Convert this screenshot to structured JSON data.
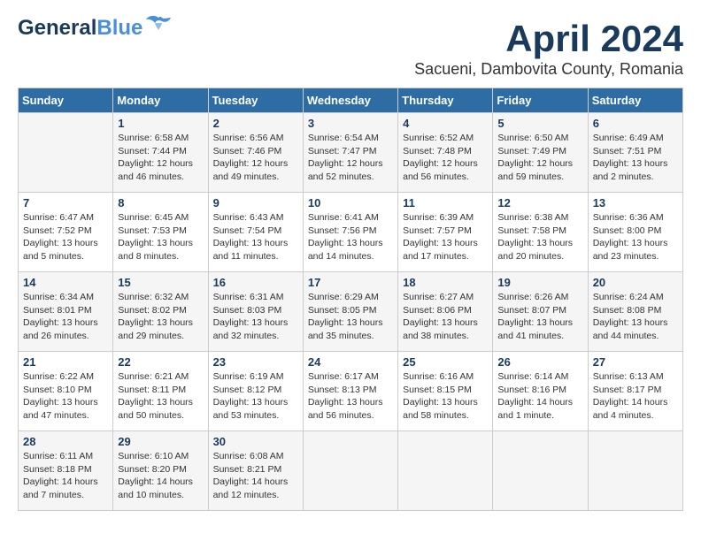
{
  "header": {
    "logo_general": "General",
    "logo_blue": "Blue",
    "month_title": "April 2024",
    "subtitle": "Sacueni, Dambovita County, Romania"
  },
  "days_of_week": [
    "Sunday",
    "Monday",
    "Tuesday",
    "Wednesday",
    "Thursday",
    "Friday",
    "Saturday"
  ],
  "weeks": [
    [
      {
        "day": "",
        "info": ""
      },
      {
        "day": "1",
        "info": "Sunrise: 6:58 AM\nSunset: 7:44 PM\nDaylight: 12 hours\nand 46 minutes."
      },
      {
        "day": "2",
        "info": "Sunrise: 6:56 AM\nSunset: 7:46 PM\nDaylight: 12 hours\nand 49 minutes."
      },
      {
        "day": "3",
        "info": "Sunrise: 6:54 AM\nSunset: 7:47 PM\nDaylight: 12 hours\nand 52 minutes."
      },
      {
        "day": "4",
        "info": "Sunrise: 6:52 AM\nSunset: 7:48 PM\nDaylight: 12 hours\nand 56 minutes."
      },
      {
        "day": "5",
        "info": "Sunrise: 6:50 AM\nSunset: 7:49 PM\nDaylight: 12 hours\nand 59 minutes."
      },
      {
        "day": "6",
        "info": "Sunrise: 6:49 AM\nSunset: 7:51 PM\nDaylight: 13 hours\nand 2 minutes."
      }
    ],
    [
      {
        "day": "7",
        "info": "Sunrise: 6:47 AM\nSunset: 7:52 PM\nDaylight: 13 hours\nand 5 minutes."
      },
      {
        "day": "8",
        "info": "Sunrise: 6:45 AM\nSunset: 7:53 PM\nDaylight: 13 hours\nand 8 minutes."
      },
      {
        "day": "9",
        "info": "Sunrise: 6:43 AM\nSunset: 7:54 PM\nDaylight: 13 hours\nand 11 minutes."
      },
      {
        "day": "10",
        "info": "Sunrise: 6:41 AM\nSunset: 7:56 PM\nDaylight: 13 hours\nand 14 minutes."
      },
      {
        "day": "11",
        "info": "Sunrise: 6:39 AM\nSunset: 7:57 PM\nDaylight: 13 hours\nand 17 minutes."
      },
      {
        "day": "12",
        "info": "Sunrise: 6:38 AM\nSunset: 7:58 PM\nDaylight: 13 hours\nand 20 minutes."
      },
      {
        "day": "13",
        "info": "Sunrise: 6:36 AM\nSunset: 8:00 PM\nDaylight: 13 hours\nand 23 minutes."
      }
    ],
    [
      {
        "day": "14",
        "info": "Sunrise: 6:34 AM\nSunset: 8:01 PM\nDaylight: 13 hours\nand 26 minutes."
      },
      {
        "day": "15",
        "info": "Sunrise: 6:32 AM\nSunset: 8:02 PM\nDaylight: 13 hours\nand 29 minutes."
      },
      {
        "day": "16",
        "info": "Sunrise: 6:31 AM\nSunset: 8:03 PM\nDaylight: 13 hours\nand 32 minutes."
      },
      {
        "day": "17",
        "info": "Sunrise: 6:29 AM\nSunset: 8:05 PM\nDaylight: 13 hours\nand 35 minutes."
      },
      {
        "day": "18",
        "info": "Sunrise: 6:27 AM\nSunset: 8:06 PM\nDaylight: 13 hours\nand 38 minutes."
      },
      {
        "day": "19",
        "info": "Sunrise: 6:26 AM\nSunset: 8:07 PM\nDaylight: 13 hours\nand 41 minutes."
      },
      {
        "day": "20",
        "info": "Sunrise: 6:24 AM\nSunset: 8:08 PM\nDaylight: 13 hours\nand 44 minutes."
      }
    ],
    [
      {
        "day": "21",
        "info": "Sunrise: 6:22 AM\nSunset: 8:10 PM\nDaylight: 13 hours\nand 47 minutes."
      },
      {
        "day": "22",
        "info": "Sunrise: 6:21 AM\nSunset: 8:11 PM\nDaylight: 13 hours\nand 50 minutes."
      },
      {
        "day": "23",
        "info": "Sunrise: 6:19 AM\nSunset: 8:12 PM\nDaylight: 13 hours\nand 53 minutes."
      },
      {
        "day": "24",
        "info": "Sunrise: 6:17 AM\nSunset: 8:13 PM\nDaylight: 13 hours\nand 56 minutes."
      },
      {
        "day": "25",
        "info": "Sunrise: 6:16 AM\nSunset: 8:15 PM\nDaylight: 13 hours\nand 58 minutes."
      },
      {
        "day": "26",
        "info": "Sunrise: 6:14 AM\nSunset: 8:16 PM\nDaylight: 14 hours\nand 1 minute."
      },
      {
        "day": "27",
        "info": "Sunrise: 6:13 AM\nSunset: 8:17 PM\nDaylight: 14 hours\nand 4 minutes."
      }
    ],
    [
      {
        "day": "28",
        "info": "Sunrise: 6:11 AM\nSunset: 8:18 PM\nDaylight: 14 hours\nand 7 minutes."
      },
      {
        "day": "29",
        "info": "Sunrise: 6:10 AM\nSunset: 8:20 PM\nDaylight: 14 hours\nand 10 minutes."
      },
      {
        "day": "30",
        "info": "Sunrise: 6:08 AM\nSunset: 8:21 PM\nDaylight: 14 hours\nand 12 minutes."
      },
      {
        "day": "",
        "info": ""
      },
      {
        "day": "",
        "info": ""
      },
      {
        "day": "",
        "info": ""
      },
      {
        "day": "",
        "info": ""
      }
    ]
  ]
}
